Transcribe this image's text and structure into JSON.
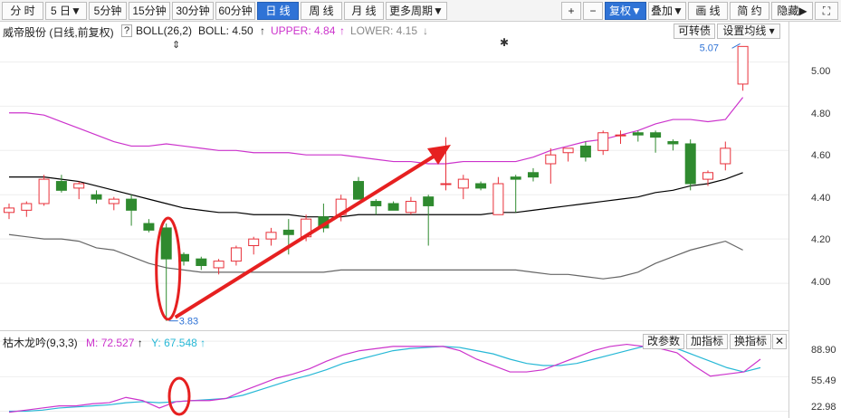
{
  "toolbar": {
    "buttons": [
      "分 时",
      "5 日▼",
      "5分钟",
      "15分钟",
      "30分钟",
      "60分钟",
      "日 线",
      "周 线",
      "月 线",
      "更多周期▼"
    ],
    "right_buttons": [
      "+",
      "−",
      "复权▼",
      "叠加▼",
      "画 线",
      "简 约",
      "隐藏▶",
      "⛶"
    ]
  },
  "info": {
    "stock": "威帝股份 (日线,前复权)",
    "help": "?",
    "boll_label": "BOLL(26,2)",
    "boll_value": "BOLL: 4.50",
    "upper": "UPPER: 4.84",
    "lower": "LOWER: 4.15",
    "conv_btn": "可转债",
    "ma_btn": "设置均线 ▾"
  },
  "price_axis": [
    "5.00",
    "4.80",
    "4.60",
    "4.40",
    "4.20",
    "4.00"
  ],
  "annotations": {
    "low": "3.83",
    "high": "5.07"
  },
  "indicator": {
    "title": "枯木龙吟(9,3,3)",
    "m": "M: 72.527",
    "y": "Y: 67.548",
    "buttons": [
      "改参数",
      "加指标",
      "换指标",
      "✕"
    ],
    "axis": [
      "88.90",
      "55.49",
      "22.98"
    ]
  },
  "colors": {
    "up": "#e8313a",
    "down": "#2f8a2f",
    "upper": "#cc33cc",
    "mid": "#000000",
    "lower": "#666666",
    "accent": "#2f73d6"
  },
  "chart_data": {
    "type": "candlestick",
    "candles": [
      [
        4.32,
        4.36,
        4.29,
        4.34
      ],
      [
        4.33,
        4.37,
        4.3,
        4.36
      ],
      [
        4.36,
        4.49,
        4.35,
        4.47
      ],
      [
        4.46,
        4.49,
        4.41,
        4.42
      ],
      [
        4.43,
        4.46,
        4.38,
        4.45
      ],
      [
        4.4,
        4.42,
        4.36,
        4.38
      ],
      [
        4.36,
        4.39,
        4.33,
        4.38
      ],
      [
        4.38,
        4.4,
        4.26,
        4.33
      ],
      [
        4.27,
        4.29,
        4.23,
        4.24
      ],
      [
        4.25,
        4.27,
        3.83,
        4.11
      ],
      [
        4.13,
        4.14,
        4.08,
        4.1
      ],
      [
        4.11,
        4.12,
        4.06,
        4.08
      ],
      [
        4.07,
        4.11,
        4.04,
        4.1
      ],
      [
        4.1,
        4.17,
        4.08,
        4.16
      ],
      [
        4.17,
        4.21,
        4.13,
        4.2
      ],
      [
        4.2,
        4.25,
        4.17,
        4.23
      ],
      [
        4.24,
        4.29,
        4.13,
        4.22
      ],
      [
        4.21,
        4.31,
        4.19,
        4.29
      ],
      [
        4.3,
        4.36,
        4.23,
        4.25
      ],
      [
        4.31,
        4.4,
        4.28,
        4.38
      ],
      [
        4.46,
        4.48,
        4.38,
        4.38
      ],
      [
        4.37,
        4.38,
        4.31,
        4.35
      ],
      [
        4.36,
        4.37,
        4.33,
        4.33
      ],
      [
        4.32,
        4.39,
        4.31,
        4.37
      ],
      [
        4.39,
        4.4,
        4.17,
        4.35
      ],
      [
        4.45,
        4.66,
        4.42,
        4.45
      ],
      [
        4.43,
        4.49,
        4.38,
        4.47
      ],
      [
        4.45,
        4.46,
        4.42,
        4.43
      ],
      [
        4.31,
        4.48,
        4.31,
        4.45
      ],
      [
        4.48,
        4.49,
        4.32,
        4.47
      ],
      [
        4.5,
        4.52,
        4.46,
        4.48
      ],
      [
        4.54,
        4.61,
        4.45,
        4.58
      ],
      [
        4.59,
        4.61,
        4.55,
        4.61
      ],
      [
        4.62,
        4.64,
        4.55,
        4.57
      ],
      [
        4.6,
        4.69,
        4.58,
        4.68
      ],
      [
        4.67,
        4.69,
        4.63,
        4.67
      ],
      [
        4.68,
        4.69,
        4.64,
        4.67
      ],
      [
        4.68,
        4.69,
        4.59,
        4.66
      ],
      [
        4.64,
        4.65,
        4.6,
        4.63
      ],
      [
        4.63,
        4.65,
        4.42,
        4.45
      ],
      [
        4.47,
        4.51,
        4.44,
        4.5
      ],
      [
        4.54,
        4.64,
        4.51,
        4.61
      ],
      [
        4.9,
        5.07,
        4.87,
        5.07
      ]
    ],
    "upper": [
      4.77,
      4.77,
      4.76,
      4.73,
      4.7,
      4.67,
      4.64,
      4.62,
      4.62,
      4.63,
      4.62,
      4.61,
      4.6,
      4.6,
      4.59,
      4.59,
      4.59,
      4.58,
      4.58,
      4.58,
      4.57,
      4.56,
      4.55,
      4.55,
      4.54,
      4.54,
      4.55,
      4.55,
      4.55,
      4.55,
      4.57,
      4.6,
      4.62,
      4.64,
      4.65,
      4.67,
      4.69,
      4.72,
      4.74,
      4.74,
      4.73,
      4.74,
      4.84
    ],
    "mid": [
      4.48,
      4.48,
      4.48,
      4.47,
      4.46,
      4.44,
      4.42,
      4.4,
      4.38,
      4.36,
      4.34,
      4.33,
      4.32,
      4.32,
      4.31,
      4.31,
      4.31,
      4.3,
      4.3,
      4.3,
      4.31,
      4.31,
      4.31,
      4.31,
      4.31,
      4.31,
      4.31,
      4.31,
      4.32,
      4.32,
      4.33,
      4.34,
      4.35,
      4.36,
      4.37,
      4.38,
      4.39,
      4.41,
      4.42,
      4.44,
      4.45,
      4.47,
      4.5
    ],
    "lower": [
      4.22,
      4.21,
      4.2,
      4.2,
      4.19,
      4.16,
      4.15,
      4.12,
      4.09,
      4.07,
      4.06,
      4.05,
      4.05,
      4.05,
      4.05,
      4.05,
      4.05,
      4.05,
      4.05,
      4.06,
      4.06,
      4.06,
      4.06,
      4.06,
      4.06,
      4.06,
      4.06,
      4.06,
      4.06,
      4.06,
      4.05,
      4.04,
      4.04,
      4.03,
      4.02,
      4.03,
      4.05,
      4.09,
      4.12,
      4.15,
      4.17,
      4.19,
      4.15
    ],
    "ylim": [
      3.8,
      5.1
    ],
    "ind_m": [
      22,
      24,
      26,
      28,
      28,
      30,
      31,
      36,
      33,
      26,
      32,
      33,
      33,
      35,
      42,
      48,
      54,
      58,
      63,
      70,
      76,
      80,
      82,
      84,
      84,
      84,
      84,
      80,
      72,
      66,
      60,
      60,
      62,
      68,
      74,
      80,
      84,
      86,
      84,
      82,
      78,
      66,
      56,
      58,
      60,
      72
    ],
    "ind_y": [
      23,
      23,
      24,
      26,
      27,
      28,
      29,
      31,
      32,
      31,
      32,
      33,
      34,
      35,
      38,
      43,
      48,
      53,
      57,
      62,
      68,
      72,
      76,
      80,
      82,
      83,
      84,
      83,
      80,
      77,
      72,
      68,
      66,
      66,
      68,
      72,
      76,
      80,
      84,
      84,
      82,
      76,
      70,
      64,
      60,
      64
    ],
    "ind_ylim": [
      20,
      95
    ]
  }
}
